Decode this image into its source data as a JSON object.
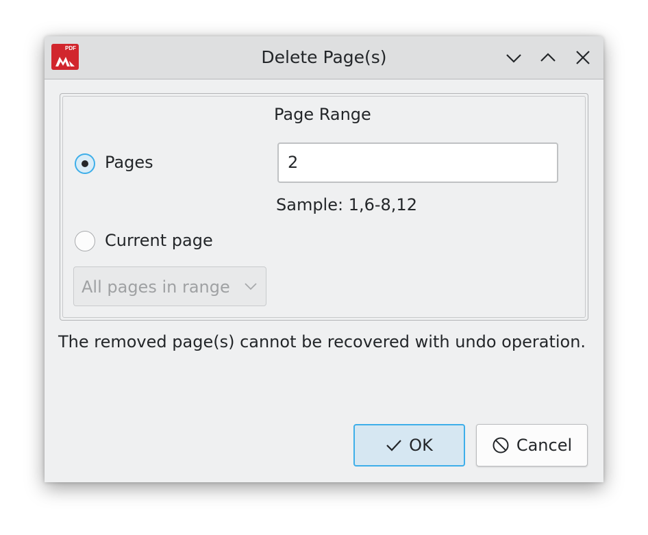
{
  "window": {
    "title": "Delete Page(s)",
    "app_icon_text": "PDF",
    "controls": [
      "minimize",
      "maximize",
      "close"
    ]
  },
  "group": {
    "heading": "Page Range"
  },
  "pages_option": {
    "label": "Pages",
    "selected": true
  },
  "pages_input": {
    "value": "2"
  },
  "sample_hint": "Sample: 1,6-8,12",
  "current_page_option": {
    "label": "Current page",
    "selected": false
  },
  "range_combo": {
    "value": "All pages in range",
    "enabled": false
  },
  "warning_text": "The removed page(s) cannot be recovered with undo operation.",
  "buttons": {
    "ok_label": "OK",
    "cancel_label": "Cancel"
  },
  "colors": {
    "accent": "#3daee9",
    "app_icon": "#d1262d",
    "window_bg": "#eff0f1"
  }
}
